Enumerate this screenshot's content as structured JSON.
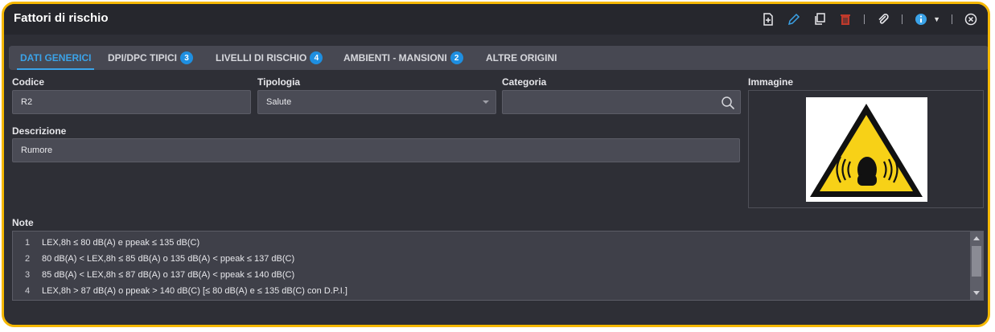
{
  "window": {
    "title": "Fattori di rischio"
  },
  "toolbar": {
    "icons": [
      "new-document-icon",
      "edit-pencil-icon",
      "copy-icon",
      "delete-trash-icon",
      "attach-paperclip-icon",
      "info-icon",
      "close-circle-icon"
    ],
    "colors": {
      "edit": "#3ba3e8",
      "delete": "#c0392b",
      "info": "#3ba3e8"
    }
  },
  "tabs": [
    {
      "label": "DATI GENERICI",
      "badge": null
    },
    {
      "label": "DPI/DPC TIPICI",
      "badge": "3"
    },
    {
      "label": "LIVELLI DI RISCHIO",
      "badge": "4"
    },
    {
      "label": "AMBIENTI - MANSIONI",
      "badge": "2"
    },
    {
      "label": "ALTRE ORIGINI",
      "badge": null
    }
  ],
  "form": {
    "codice": {
      "label": "Codice",
      "value": "R2"
    },
    "tipologia": {
      "label": "Tipologia",
      "value": "Salute"
    },
    "categoria": {
      "label": "Categoria",
      "value": ""
    },
    "immagine": {
      "label": "Immagine",
      "image": "noise-hazard-warning-sign"
    },
    "descrizione": {
      "label": "Descrizione",
      "value": "Rumore"
    },
    "note": {
      "label": "Note",
      "lines": [
        {
          "n": "1",
          "text": "LEX,8h ≤ 80 dB(A) e ppeak ≤ 135 dB(C)"
        },
        {
          "n": "2",
          "text": "80 dB(A) < LEX,8h ≤ 85 dB(A) o 135 dB(A) < ppeak ≤ 137 dB(C)"
        },
        {
          "n": "3",
          "text": "85 dB(A) < LEX,8h ≤ 87 dB(A) o 137 dB(A) < ppeak ≤ 140 dB(C)"
        },
        {
          "n": "4",
          "text": "LEX,8h > 87 dB(A) o ppeak > 140 dB(C) [≤ 80 dB(A) e ≤ 135 dB(C) con D.P.I.]"
        }
      ]
    }
  },
  "colors": {
    "accent": "#3ba3e8",
    "frame": "#f5b800",
    "warning_yellow": "#f7d117"
  }
}
